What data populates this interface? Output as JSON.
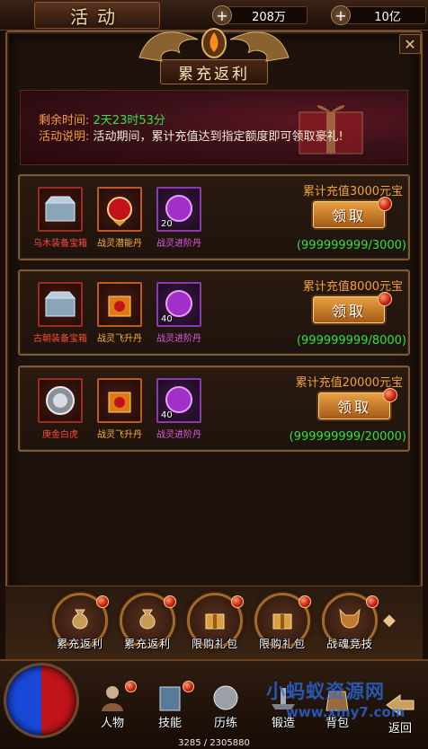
{
  "window": {
    "title": "活动"
  },
  "resources": [
    {
      "icon": "coin-bag-icon",
      "value": "208万"
    },
    {
      "icon": "gold-ingot-icon",
      "value": "10亿"
    }
  ],
  "panel": {
    "header": "累充返利"
  },
  "info": {
    "remaining_label": "剩余时间:",
    "remaining_value": "2天23时53分",
    "desc_label": "活动说明:",
    "desc_value": "活动期间，累计充值达到指定额度即可领取豪礼!"
  },
  "rewards": [
    {
      "target": "累计充值3000元宝",
      "claim_label": "领取",
      "progress": "(999999999/3000)",
      "items": [
        {
          "name": "乌木装备宝箱",
          "icon": "chest-icon",
          "count": ""
        },
        {
          "name": "战灵潜能丹",
          "icon": "red-orb-icon",
          "count": ""
        },
        {
          "name": "战灵进阶丹",
          "icon": "purple-orb-icon",
          "count": "20"
        }
      ]
    },
    {
      "target": "累计充值8000元宝",
      "claim_label": "领取",
      "progress": "(999999999/8000)",
      "items": [
        {
          "name": "古朝装备宝箱",
          "icon": "chest-icon",
          "count": ""
        },
        {
          "name": "战灵飞升丹",
          "icon": "gold-box-icon",
          "count": ""
        },
        {
          "name": "战灵进阶丹",
          "icon": "purple-orb-icon",
          "count": "40"
        }
      ]
    },
    {
      "target": "累计充值20000元宝",
      "claim_label": "领取",
      "progress": "(999999999/20000)",
      "items": [
        {
          "name": "庚金白虎",
          "icon": "white-tiger-icon",
          "count": ""
        },
        {
          "name": "战灵飞升丹",
          "icon": "gold-box-icon",
          "count": ""
        },
        {
          "name": "战灵进阶丹",
          "icon": "purple-orb-icon",
          "count": "40"
        }
      ]
    }
  ],
  "tabs": [
    {
      "label": "累充返利",
      "icon": "money-bag-icon"
    },
    {
      "label": "累充返利",
      "icon": "money-bag-icon"
    },
    {
      "label": "限购礼包",
      "icon": "gift-box-icon"
    },
    {
      "label": "限购礼包",
      "icon": "gift-box-icon"
    },
    {
      "label": "战魂竞技",
      "icon": "demon-mask-icon"
    }
  ],
  "nav": [
    {
      "label": "人物",
      "icon": "character-icon"
    },
    {
      "label": "技能",
      "icon": "skill-book-icon"
    },
    {
      "label": "历练",
      "icon": "training-icon"
    },
    {
      "label": "锻造",
      "icon": "forge-icon"
    },
    {
      "label": "背包",
      "icon": "bag-icon"
    },
    {
      "label": "返回",
      "icon": "return-icon"
    }
  ],
  "exp": "3285 / 2305880",
  "watermark": {
    "line1": "小蚂蚁资源网",
    "line2": "www.xmy7.com"
  },
  "colors": {
    "green": "#35e04a",
    "orange": "#f2a03a",
    "gold_border": "#7a5a36"
  }
}
